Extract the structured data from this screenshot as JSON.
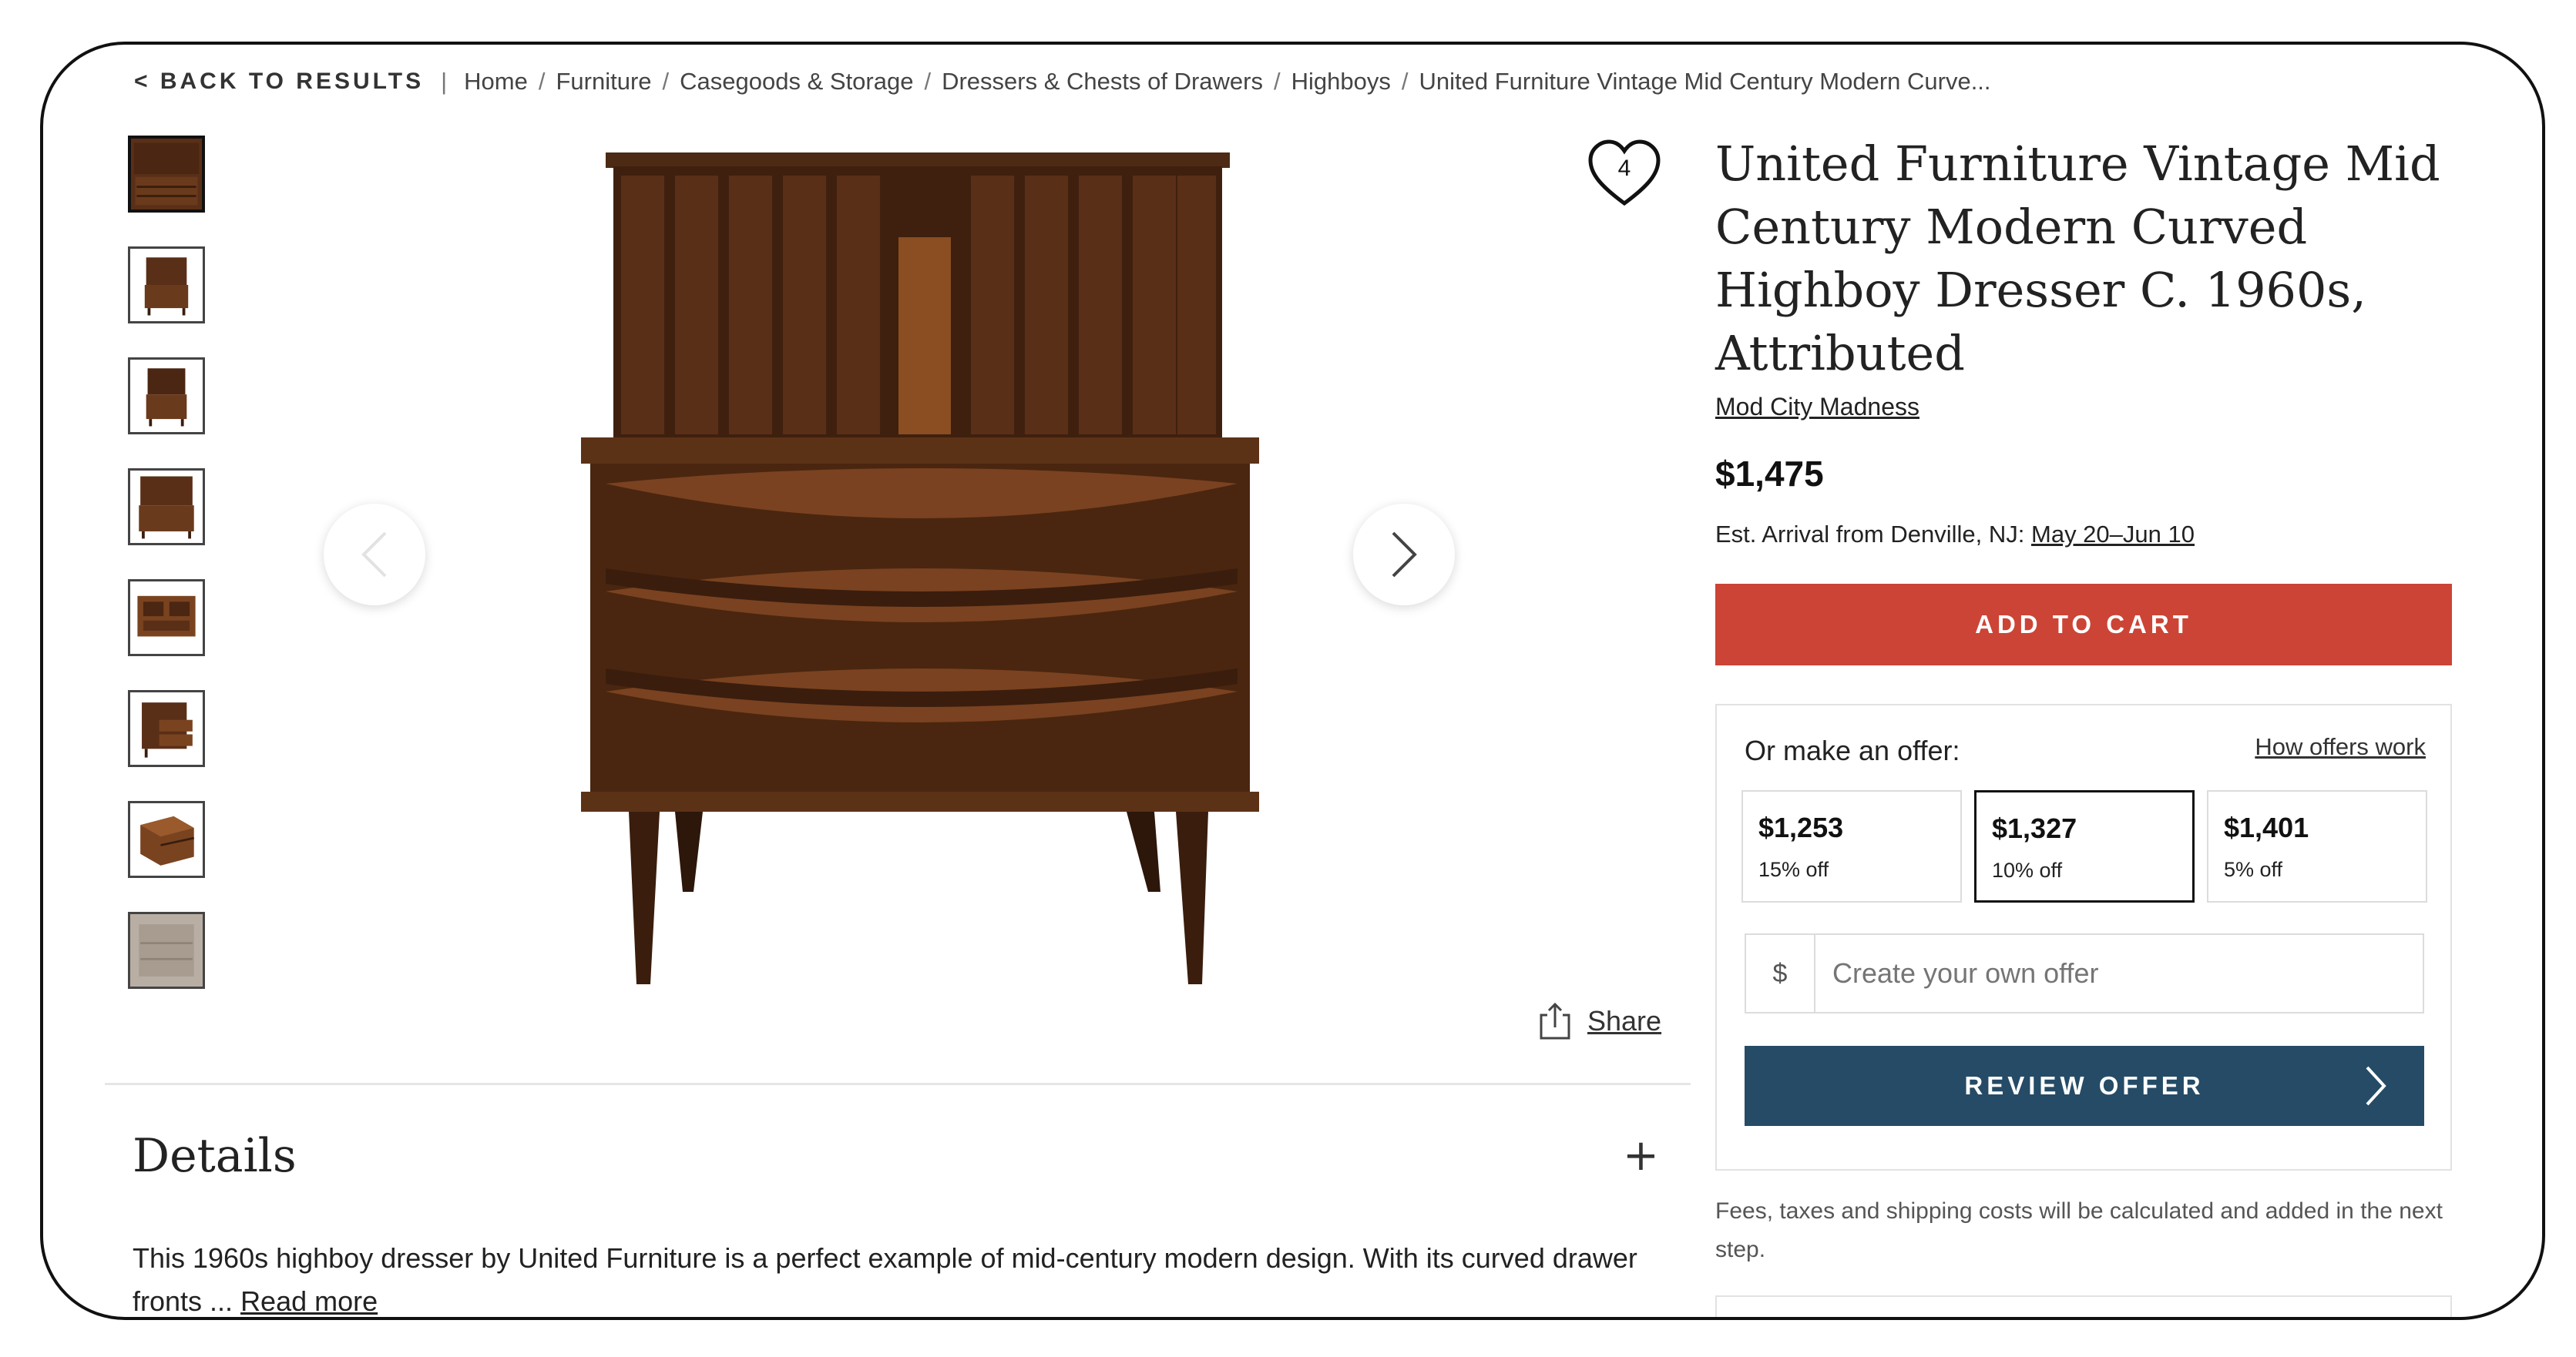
{
  "breadcrumb": {
    "back_label": "< BACK TO RESULTS",
    "divider": "|",
    "items": [
      "Home",
      "Furniture",
      "Casegoods & Storage",
      "Dressers & Chests of Drawers",
      "Highboys",
      "United Furniture Vintage Mid Century Modern Curve..."
    ]
  },
  "gallery": {
    "thumbnail_count": 8,
    "prev_icon": "chevron-left-icon",
    "next_icon": "chevron-right-icon"
  },
  "share_label": "Share",
  "favorites_count": "4",
  "product": {
    "title": "United Furniture Vintage Mid Century Modern Curved Highboy Dresser C. 1960s, Attributed",
    "seller": "Mod City Madness",
    "price": "$1,475",
    "arrival_prefix": "Est. Arrival from Denville, NJ:",
    "arrival_dates": "May 20–Jun 10"
  },
  "cart": {
    "label": "ADD TO CART",
    "color": "#cc4436"
  },
  "offer": {
    "label": "Or make an offer:",
    "how_link": "How offers work",
    "options": [
      {
        "amount": "$1,253",
        "discount": "15% off",
        "selected": false
      },
      {
        "amount": "$1,327",
        "discount": "10% off",
        "selected": true
      },
      {
        "amount": "$1,401",
        "discount": "5% off",
        "selected": false
      }
    ],
    "currency": "$",
    "custom_placeholder": "Create your own offer",
    "review_label": "REVIEW OFFER",
    "review_color": "#254b66"
  },
  "fees_note": "Fees, taxes and shipping costs will be calculated and added in the next step.",
  "details": {
    "title": "Details",
    "description": "This 1960s highboy dresser by United Furniture is a perfect example of mid-century modern design. With its curved drawer fronts ...",
    "read_more": "Read more"
  }
}
